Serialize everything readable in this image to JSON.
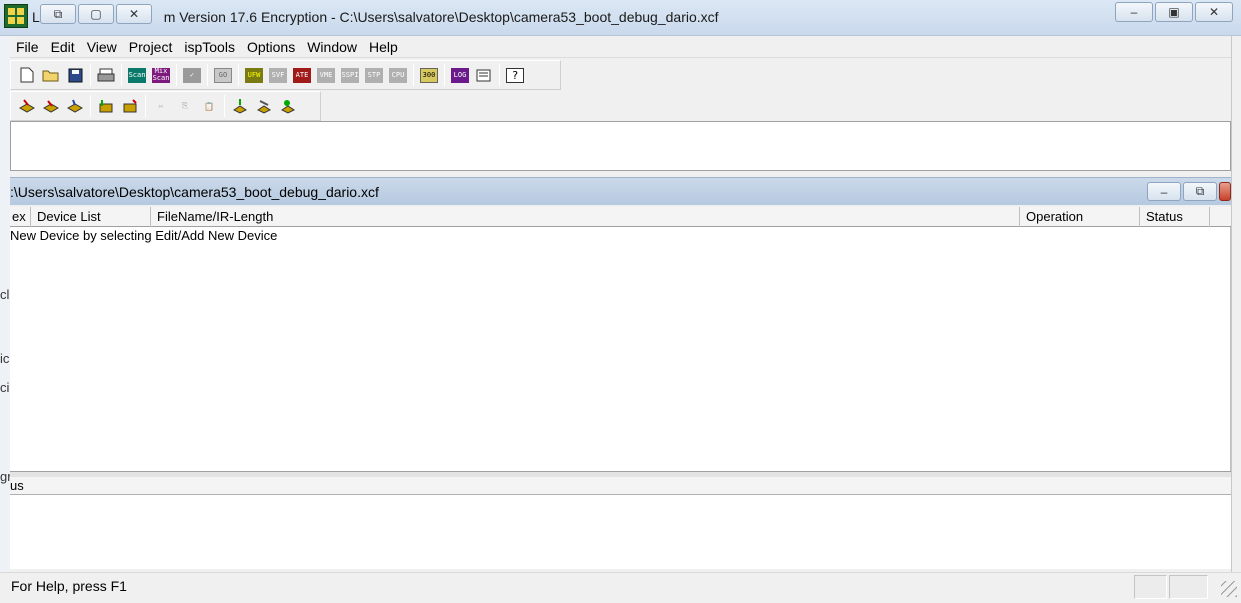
{
  "window": {
    "title_prefix": "L.",
    "title_rest": "m Version  17.6 Encryption - C:\\Users\\salvatore\\Desktop\\camera53_boot_debug_dario.xcf"
  },
  "menu": [
    "File",
    "Edit",
    "View",
    "Project",
    "ispTools",
    "Options",
    "Window",
    "Help"
  ],
  "toolbar1": {
    "scan": "Scan",
    "mixscan": "Mix Scan",
    "go": "GO",
    "ufw": "UFW",
    "svf": "SVF",
    "ate": "ATE",
    "vme": "VME",
    "sspi": "SSPI",
    "stp": "STP",
    "cpu": "CPU",
    "m300": "300",
    "log": "LOG",
    "help": "?"
  },
  "child": {
    "title": ":\\Users\\salvatore\\Desktop\\camera53_boot_debug_dario.xcf"
  },
  "table": {
    "columns": [
      "ex",
      "Device List",
      "FileName/IR-Length",
      "Operation",
      "Status"
    ],
    "hint": "New Device by selecting Edit/Add New Device"
  },
  "output": {
    "header": "us"
  },
  "statusbar": {
    "text": "For Help, press F1"
  },
  "background_leak": [
    "cl",
    "ic",
    "ci",
    "gr"
  ]
}
